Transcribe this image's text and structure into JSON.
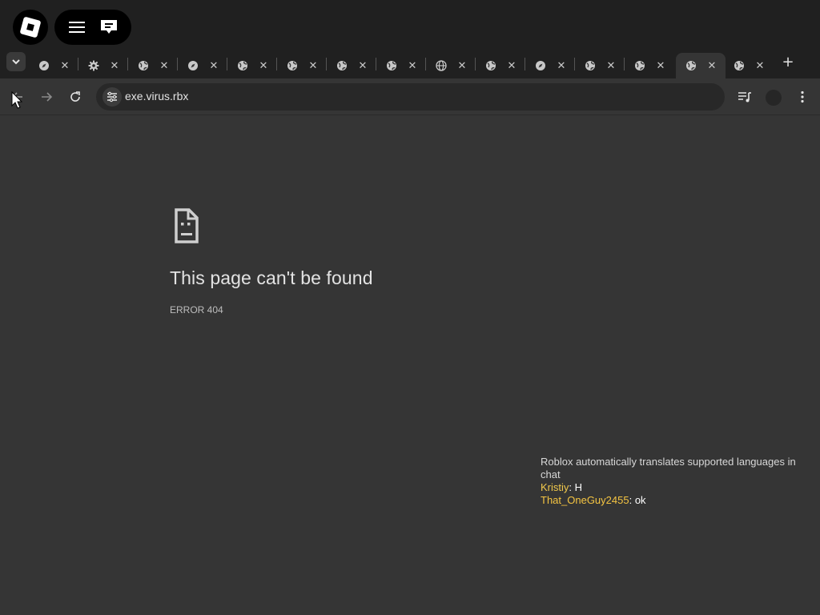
{
  "address_bar": {
    "url": "exe.virus.rbx"
  },
  "tabs": [
    {
      "icon": "compass-icon",
      "active": false
    },
    {
      "icon": "gear-icon",
      "active": false
    },
    {
      "icon": "globe-icon",
      "active": false
    },
    {
      "icon": "compass-icon",
      "active": false
    },
    {
      "icon": "globe-icon",
      "active": false
    },
    {
      "icon": "globe-icon",
      "active": false
    },
    {
      "icon": "globe-icon",
      "active": false
    },
    {
      "icon": "globe-icon",
      "active": false
    },
    {
      "icon": "globe-grid-icon",
      "active": false
    },
    {
      "icon": "globe-icon",
      "active": false
    },
    {
      "icon": "compass-icon",
      "active": false
    },
    {
      "icon": "globe-icon",
      "active": false
    },
    {
      "icon": "globe-icon",
      "active": false
    },
    {
      "icon": "globe-icon",
      "active": true
    },
    {
      "icon": "globe-icon",
      "active": false
    }
  ],
  "error_page": {
    "title": "This page can't be found",
    "code": "ERROR 404"
  },
  "chat": {
    "system_message": "Roblox automatically translates supported languages in chat",
    "messages": [
      {
        "user": "Kristiy",
        "separator": ": ",
        "text": "H",
        "color": "#f2c94c"
      },
      {
        "user": "That_OneGuy2455",
        "separator": ": ",
        "text": "ok",
        "color": "#f5c542"
      }
    ]
  },
  "colors": {
    "page_background": "#353535",
    "tabstrip_background": "#202020",
    "omnibox_background": "#282828",
    "text_primary": "#e3e3e3"
  }
}
